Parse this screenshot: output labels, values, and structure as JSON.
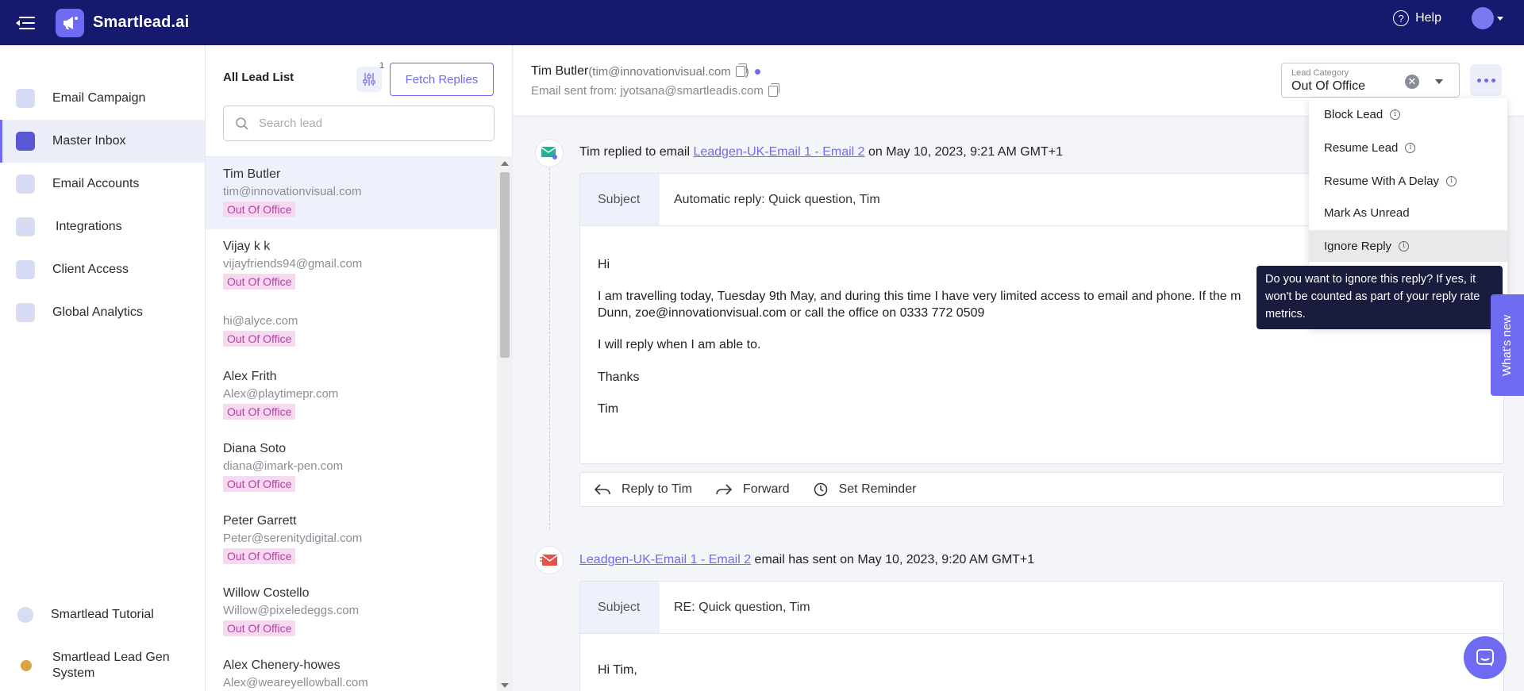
{
  "app": {
    "name": "Smartlead.ai"
  },
  "header": {
    "help_label": "Help"
  },
  "sidebar": {
    "items": [
      {
        "label": "Email Campaign",
        "icon": "campaign-icon"
      },
      {
        "label": "Master Inbox",
        "icon": "inbox-icon",
        "active": true
      },
      {
        "label": "Email Accounts",
        "icon": "mail-icon"
      },
      {
        "label": "Integrations",
        "icon": "puzzle-icon"
      },
      {
        "label": "Client Access",
        "icon": "bolt-icon"
      },
      {
        "label": "Global Analytics",
        "icon": "chart-icon"
      }
    ],
    "bottom": [
      {
        "label": "Smartlead Tutorial",
        "icon": "play-icon"
      },
      {
        "label": "Smartlead Lead Gen System",
        "icon": "moneybag-icon"
      }
    ]
  },
  "leads": {
    "title": "All Lead List",
    "filter_count": "1",
    "fetch_label": "Fetch Replies",
    "search_placeholder": "Search lead",
    "items": [
      {
        "name": "Tim Butler",
        "email": "tim@innovationvisual.com",
        "tag": "Out Of Office"
      },
      {
        "name": "Vijay k k",
        "email": "vijayfriends94@gmail.com",
        "tag": "Out Of Office"
      },
      {
        "name": "",
        "email": "hi@alyce.com",
        "tag": "Out Of Office"
      },
      {
        "name": "Alex Frith",
        "email": "Alex@playtimepr.com",
        "tag": "Out Of Office"
      },
      {
        "name": "Diana Soto",
        "email": "diana@imark-pen.com",
        "tag": "Out Of Office"
      },
      {
        "name": "Peter Garrett",
        "email": "Peter@serenitydigital.com",
        "tag": "Out Of Office"
      },
      {
        "name": "Willow Costello",
        "email": "Willow@pixeledeggs.com",
        "tag": "Out Of Office"
      },
      {
        "name": "Alex Chenery-howes",
        "email": "Alex@weareyellowball.com",
        "tag": ""
      }
    ]
  },
  "thread": {
    "lead_name": "Tim Butler",
    "lead_email": "(tim@innovationvisual.com",
    "lead_email_close": ")",
    "sent_from": "Email sent from: jyotsana@smartleadis.com",
    "lead_category_label": "Lead Category",
    "lead_category_value": "Out Of Office",
    "events": [
      {
        "prefix": "Tim replied to email ",
        "link": "Leadgen-UK-Email 1 - Email 2",
        "suffix": " on May 10, 2023, 9:21 AM GMT+1",
        "subject_label": "Subject",
        "subject": "Automatic reply: Quick question, Tim",
        "body": [
          "Hi",
          "I am travelling today, Tuesday 9th May, and during this time I have very limited access to email and phone.  If the m",
          "Dunn, zoe@innovationvisual.com or call the office on 0333 772 0509",
          "I will reply when I am able to.",
          "Thanks",
          "Tim"
        ]
      },
      {
        "prefix": "",
        "link": "Leadgen-UK-Email 1 - Email 2",
        "suffix": " email has sent on May 10, 2023, 9:20 AM GMT+1",
        "subject_label": "Subject",
        "subject": "RE: Quick question, Tim",
        "body": [
          "Hi Tim,"
        ]
      }
    ],
    "actions": {
      "reply": "Reply to Tim",
      "forward": "Forward",
      "reminder": "Set Reminder"
    }
  },
  "menu": {
    "items": [
      "Block Lead",
      "Resume Lead",
      "Resume With A Delay",
      "Mark As Unread",
      "Ignore Reply"
    ],
    "tooltip": "Do you want to ignore this reply? If yes, it won't be counted as part of your reply rate metrics."
  },
  "whats_new_label": "What's new",
  "colors": {
    "topbar": "#151a6e",
    "accent": "#6e6bf2",
    "tag_bg": "#f6d8f0",
    "tag_text": "#b93fa5"
  }
}
